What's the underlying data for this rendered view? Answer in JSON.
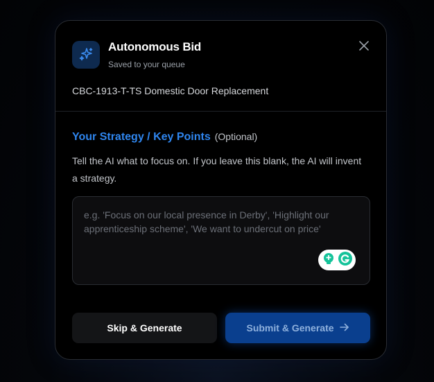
{
  "header": {
    "title": "Autonomous Bid",
    "subtitle": "Saved to your queue",
    "icon": "sparkles-icon",
    "close_icon": "close-icon"
  },
  "project": {
    "name": "CBC-1913-T-TS Domestic Door Replacement"
  },
  "strategy": {
    "title": "Your Strategy / Key Points",
    "optional": "(Optional)",
    "help": "Tell the AI what to focus on. If you leave this blank, the AI will invent a strategy.",
    "placeholder": "e.g. 'Focus on our local presence in Derby', 'Highlight our apprenticeship scheme', 'We want to undercut on price'",
    "value": ""
  },
  "actions": {
    "skip_label": "Skip & Generate",
    "submit_label": "Submit & Generate",
    "submit_icon": "arrow-right-icon"
  },
  "colors": {
    "accent": "#2f86ef",
    "submit_bg": "#0a3f8e",
    "modal_bg": "#000000"
  }
}
